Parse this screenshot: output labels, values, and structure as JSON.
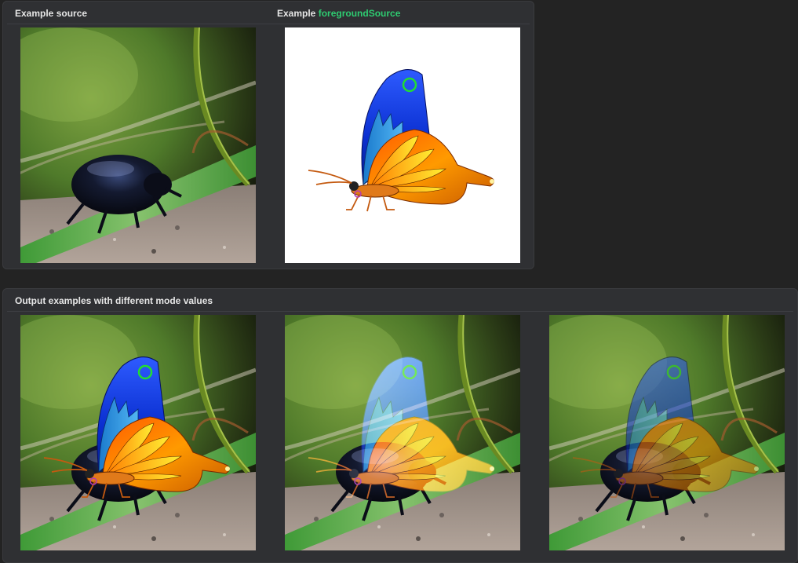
{
  "top_panel": {
    "source_title": "Example source",
    "foreground_title_prefix": "Example ",
    "foreground_title_code": "foregroundSource",
    "accent_color": "#2ecc71"
  },
  "bottom_panel": {
    "title": "Output examples with different mode values"
  },
  "images": {
    "source": "beetle-on-grass-photo",
    "foreground": "butterfly-illustration",
    "outputs": [
      "blend-normal",
      "blend-screen",
      "blend-overlay"
    ]
  }
}
